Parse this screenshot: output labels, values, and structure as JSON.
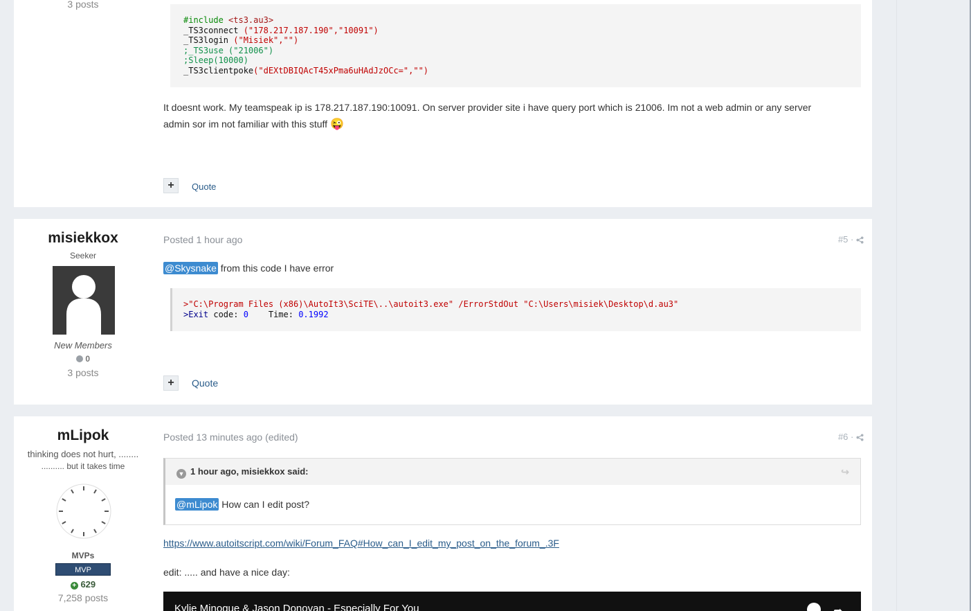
{
  "post4": {
    "postcount": "3 posts",
    "code_lines": [
      {
        "parts": [
          {
            "t": "#include ",
            "c": "#0a8a0a"
          },
          {
            "t": "<ts3.au3>",
            "c": "#a31515"
          }
        ]
      },
      {
        "parts": [
          {
            "t": "_TS3connect ",
            "c": "#111"
          },
          {
            "t": "(\"178.217.187.190\",\"10091\")",
            "c": "#c00000"
          }
        ]
      },
      {
        "parts": [
          {
            "t": "_TS3login ",
            "c": "#111"
          },
          {
            "t": "(\"Misiek\",\"\")",
            "c": "#c00000"
          }
        ]
      },
      {
        "parts": [
          {
            "t": ";_TS3use (\"21006\")",
            "c": "#10904a"
          }
        ]
      },
      {
        "parts": [
          {
            "t": ";Sleep(10000)",
            "c": "#10904a"
          }
        ]
      },
      {
        "parts": [
          {
            "t": "_TS3clientpoke",
            "c": "#111"
          },
          {
            "t": "(\"dEXtDBIQAcT45xPma6uHAdJzOCc=\",\"\")",
            "c": "#c00000"
          }
        ]
      }
    ],
    "body_line1": "It doesnt work. My teamspeak ip is 178.217.187.190:10091. On server provider site i have query port which is 21006. Im not a web admin or any server",
    "body_line2": "admin sor im not familiar with this stuff",
    "emoji": "😜",
    "plus_label": "+",
    "quote_label": "Quote"
  },
  "post5": {
    "username": "misiekkox",
    "rank": "Seeker",
    "group": "New Members",
    "reputation": "0",
    "postcount": "3 posts",
    "posted": "Posted 1 hour ago",
    "post_number": "#5",
    "mention": "@Skysnake",
    "text": " from this code I have error",
    "code_lines": [
      {
        "parts": [
          {
            "t": ">\"C:\\Program Files (x86)\\AutoIt3\\SciTE\\..\\autoit3.exe\" /ErrorStdOut ",
            "c": "#c00000"
          },
          {
            "t": "\"C:\\Users\\misiek\\Desktop\\d.au3\"",
            "c": "#c00000"
          }
        ]
      },
      {
        "parts": [
          {
            "t": ">Exit ",
            "c": "#00008b"
          },
          {
            "t": "code: ",
            "c": "#111"
          },
          {
            "t": "0",
            "c": "#0000ff"
          },
          {
            "t": "    Time: ",
            "c": "#111"
          },
          {
            "t": "0.1992",
            "c": "#0000ff"
          }
        ]
      }
    ],
    "plus_label": "+",
    "quote_label": "Quote"
  },
  "post6": {
    "username": "mLipok",
    "rank_line1": "thinking does not hurt, ........",
    "rank_line2": ".......... but it takes time",
    "group": "MVPs",
    "badge": "MVP",
    "reputation": "629",
    "postcount": "7,258 posts",
    "posted": "Posted 13 minutes ago (edited)",
    "post_number": "#6",
    "quote_header": "1 hour ago, misiekkox said:",
    "quote_mention": "@mLipok",
    "quote_text": " How can I edit post?",
    "link": "https://www.autoitscript.com/wiki/Forum_FAQ#How_can_I_edit_my_post_on_the_forum_.3F",
    "edit_text": "edit: ..... and have a nice day:",
    "video_title": "Kylie Minogue & Jason Donovan - Especially For You"
  },
  "colors": {
    "accent": "#3d8bd0",
    "link": "#2a5c8a",
    "mvp_badge": "#2f4d73",
    "rep_positive": "#3a8a3a"
  }
}
